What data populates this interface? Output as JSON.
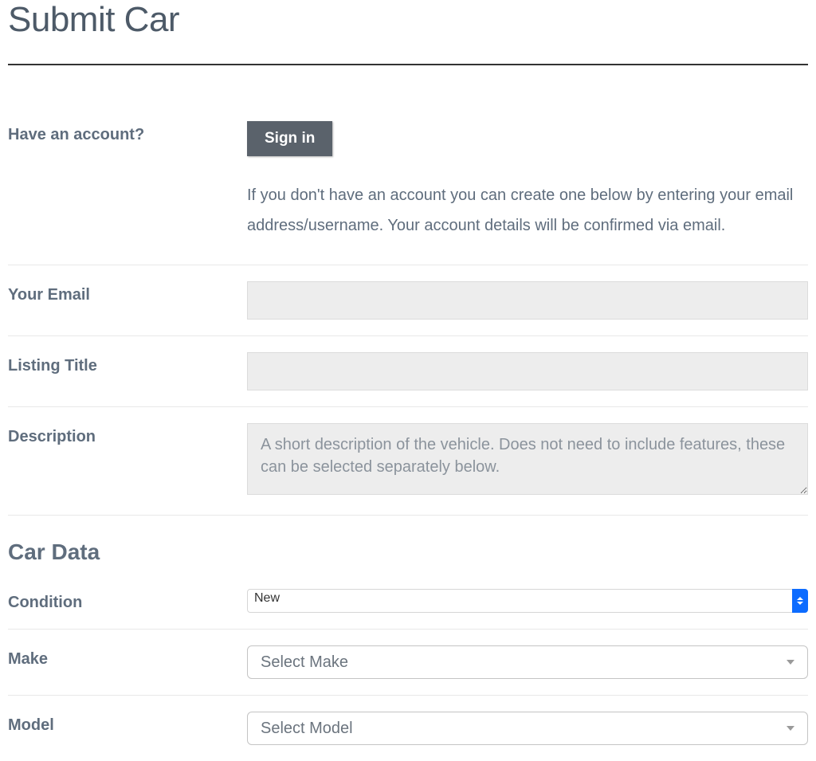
{
  "page": {
    "title": "Submit Car"
  },
  "account": {
    "label": "Have an account?",
    "signin_label": "Sign in",
    "help_text": "If you don't have an account you can create one below by entering your email address/username. Your account details will be confirmed via email."
  },
  "fields": {
    "email": {
      "label": "Your Email",
      "value": ""
    },
    "listing_title": {
      "label": "Listing Title",
      "value": ""
    },
    "description": {
      "label": "Description",
      "placeholder": "A short description of the vehicle. Does not need to include features, these can be selected separately below.",
      "value": ""
    }
  },
  "car_data": {
    "heading": "Car Data",
    "condition": {
      "label": "Condition",
      "value": "New"
    },
    "make": {
      "label": "Make",
      "value": "Select Make"
    },
    "model": {
      "label": "Model",
      "value": "Select Model"
    }
  }
}
